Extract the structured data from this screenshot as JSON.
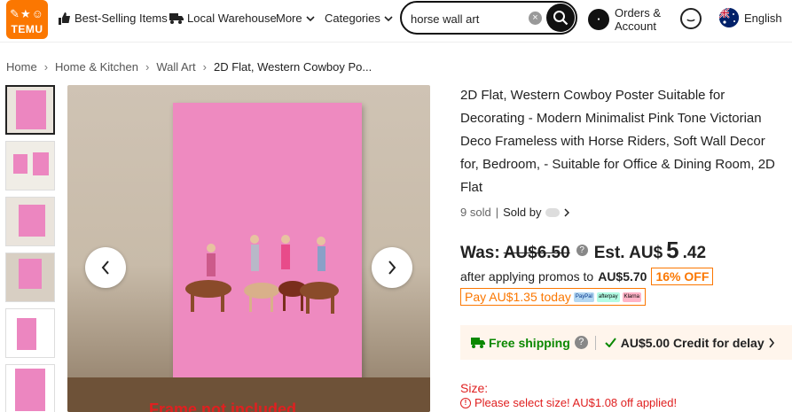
{
  "header": {
    "logo_top": "ᴛᴇᴍᴜ",
    "logo_text": "TEMU",
    "best_selling": "Best-Selling Items",
    "local_warehouse": "Local Warehouse",
    "more": "More",
    "categories": "Categories",
    "search_value": "horse wall art",
    "orders_line1": "Orders &",
    "orders_line2": "Account",
    "language": "English"
  },
  "breadcrumb": [
    "Home",
    "Home & Kitchen",
    "Wall Art",
    "2D Flat, Western Cowboy Po..."
  ],
  "gallery": {
    "frame_note": "Frame not included"
  },
  "product": {
    "title": "2D Flat, Western Cowboy Poster Suitable for Decorating - Modern Minimalist Pink Tone Victorian Deco Frameless with Horse Riders, Soft Wall Decor for, Bedroom, - Suitable for Office & Dining Room, 2D Flat",
    "sold": "9 sold",
    "sold_by": "Sold by",
    "was_label": "Was:",
    "was_price": "AU$6.50",
    "est_label": "Est. AU$",
    "price_dollars": "5",
    "price_cents": ".42",
    "promo_text": "after applying promos to",
    "promo_price": "AU$5.70",
    "discount": "16% OFF",
    "pay_text": "Pay AU$1.35 today",
    "pay_chips": [
      "PayPal",
      "afterpay",
      "Klarna"
    ],
    "free_shipping": "Free shipping",
    "credit": "AU$5.00 Credit for delay",
    "size_label": "Size:",
    "size_warning": "Please select size! AU$1.08 off applied!"
  },
  "colors": {
    "brand": "#fb7701",
    "shipping_green": "#0a8800",
    "warning_red": "#e02020",
    "poster_pink": "#ee8ac0"
  }
}
